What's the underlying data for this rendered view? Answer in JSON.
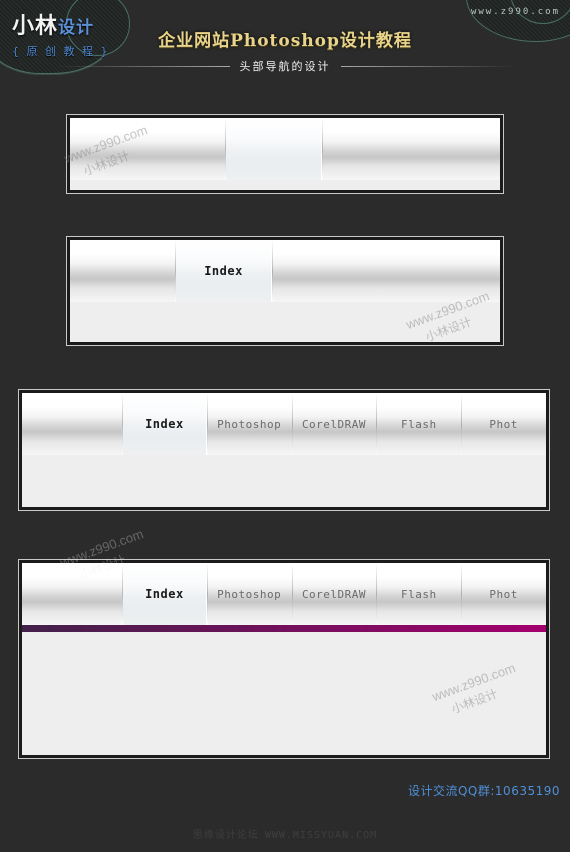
{
  "header": {
    "logo_main_white": "小林",
    "logo_main_blue": "设计",
    "logo_sub": "{ 原 创 教 程 }",
    "site_url": "www.z990.com",
    "title": "企业网站Photoshop设计教程",
    "subtitle": "头部导航的设计",
    "title_color": "#e8d48a",
    "subtitle_color": "#efefef",
    "logo_blue": "#4e86cf"
  },
  "panels": [
    {
      "id": "panel-1",
      "name": "nav-bar-blank-three-cell",
      "cells": [
        {
          "label": "",
          "active": false
        },
        {
          "label": "",
          "active": true
        },
        {
          "label": "",
          "active": false
        }
      ]
    },
    {
      "id": "panel-2",
      "name": "nav-bar-single-index",
      "cells": [
        {
          "label": "",
          "active": false
        },
        {
          "label": "Index",
          "active": true
        },
        {
          "label": "",
          "active": false
        }
      ]
    },
    {
      "id": "panel-3",
      "name": "nav-bar-full-menu",
      "cells": [
        {
          "label": "",
          "active": false
        },
        {
          "label": "Index",
          "active": true
        },
        {
          "label": "Photoshop",
          "active": false
        },
        {
          "label": "CorelDRAW",
          "active": false
        },
        {
          "label": "Flash",
          "active": false
        },
        {
          "label": "Phot",
          "active": false
        }
      ]
    },
    {
      "id": "panel-4",
      "name": "nav-bar-full-menu-with-accent",
      "cells": [
        {
          "label": "",
          "active": false
        },
        {
          "label": "Index",
          "active": true
        },
        {
          "label": "Photoshop",
          "active": false
        },
        {
          "label": "CorelDRAW",
          "active": false
        },
        {
          "label": "Flash",
          "active": false
        },
        {
          "label": "Phot",
          "active": false
        }
      ],
      "accent_from": "#43214a",
      "accent_to": "#a3006e"
    }
  ],
  "watermarks": [
    {
      "url": "www.z990.com",
      "cn": "小林设计"
    },
    {
      "url": "www.z990.com",
      "cn": "小林设计"
    },
    {
      "url": "www.z990.com",
      "cn": "小林设计"
    },
    {
      "url": "www.z990.com",
      "cn": "小林设计"
    }
  ],
  "footer": {
    "qq_text": "设计交流QQ群:10635190",
    "qq_color": "#4f8fd8",
    "forum_cn": "思缘设计论坛",
    "forum_url": "WWW.MISSYUAN.COM"
  }
}
